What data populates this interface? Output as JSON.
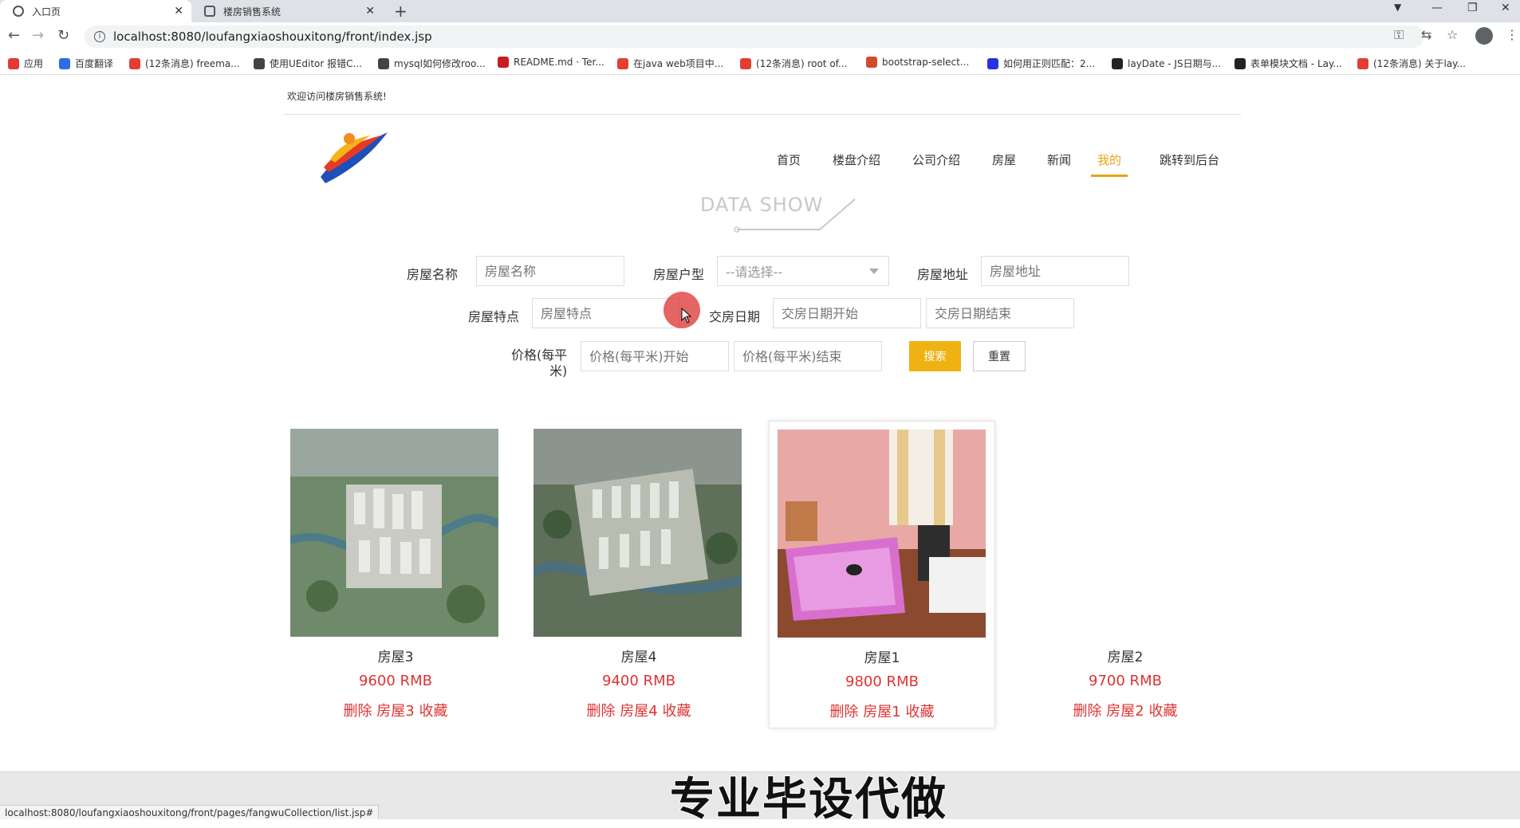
{
  "browser": {
    "tabs": [
      {
        "title": "入口页",
        "active": true
      },
      {
        "title": "楼房销售系统",
        "active": false
      }
    ],
    "url": "localhost:8080/loufangxiaoshouxitong/front/index.jsp",
    "bookmarks": [
      {
        "label": "应用",
        "icon": "apps-grid-icon",
        "color": "#e53935"
      },
      {
        "label": "百度翻译",
        "icon": "baidu-translate-icon",
        "color": "#2b6de5"
      },
      {
        "label": "(12条消息) freema...",
        "icon": "csdn-icon",
        "color": "#e33e33"
      },
      {
        "label": "使用UEditor 报错C...",
        "icon": "ueditor-icon",
        "color": "#444444"
      },
      {
        "label": "mysql如何修改roo...",
        "icon": "ueditor-icon",
        "color": "#444444"
      },
      {
        "label": "README.md · Ter...",
        "icon": "gitee-icon",
        "color": "#c71d23"
      },
      {
        "label": "在java web项目中...",
        "icon": "csdn-icon",
        "color": "#e33e33"
      },
      {
        "label": "(12条消息) root of...",
        "icon": "csdn-icon",
        "color": "#e33e33"
      },
      {
        "label": "bootstrap-select...",
        "icon": "bootstrap-icon",
        "color": "#d14b2a"
      },
      {
        "label": "如何用正则匹配：2...",
        "icon": "baidu-icon",
        "color": "#2932e1"
      },
      {
        "label": "layDate - JS日期与...",
        "icon": "layui-icon",
        "color": "#222222"
      },
      {
        "label": "表单模块文档 - Lay...",
        "icon": "layui-icon",
        "color": "#222222"
      },
      {
        "label": "(12条消息) 关于lay...",
        "icon": "csdn-icon",
        "color": "#e33e33"
      }
    ]
  },
  "page": {
    "welcome": "欢迎访问楼房销售系统!",
    "nav": [
      {
        "label": "首页",
        "active": false
      },
      {
        "label": "楼盘介绍",
        "active": false
      },
      {
        "label": "公司介绍",
        "active": false
      },
      {
        "label": "房屋",
        "active": false
      },
      {
        "label": "新闻",
        "active": false
      },
      {
        "label": "我的",
        "active": true
      },
      {
        "label": "跳转到后台",
        "active": false
      }
    ],
    "section_title": "DATA SHOW",
    "accent_color": "#e8a317",
    "price_color": "#e03232"
  },
  "search": {
    "name_label": "房屋名称",
    "name_placeholder": "房屋名称",
    "type_label": "房屋户型",
    "type_selected": "--请选择--",
    "address_label": "房屋地址",
    "address_placeholder": "房屋地址",
    "feature_label": "房屋特点",
    "feature_placeholder": "房屋特点",
    "date_label": "交房日期",
    "date_start_placeholder": "交房日期开始",
    "date_end_placeholder": "交房日期结束",
    "price_label_line1": "价格(每平",
    "price_label_line2": "米)",
    "price_start_placeholder": "价格(每平米)开始",
    "price_end_placeholder": "价格(每平米)结束",
    "search_button": "搜索",
    "reset_button": "重置"
  },
  "listings": [
    {
      "name": "房屋3",
      "price": "9600 RMB",
      "actions": "删除 房屋3 收藏",
      "image": "aerial-estate"
    },
    {
      "name": "房屋4",
      "price": "9400 RMB",
      "actions": "删除 房屋4 收藏",
      "image": "aerial-estate-2"
    },
    {
      "name": "房屋1",
      "price": "9800 RMB",
      "actions": "删除 房屋1 收藏",
      "image": "bedroom"
    },
    {
      "name": "房屋2",
      "price": "9700 RMB",
      "actions": "删除 房屋2 收藏",
      "image": "none"
    }
  ],
  "overlay": {
    "watermark": "专业毕设代做",
    "status_url": "localhost:8080/loufangxiaoshouxitong/front/pages/fangwuCollection/list.jsp#"
  }
}
